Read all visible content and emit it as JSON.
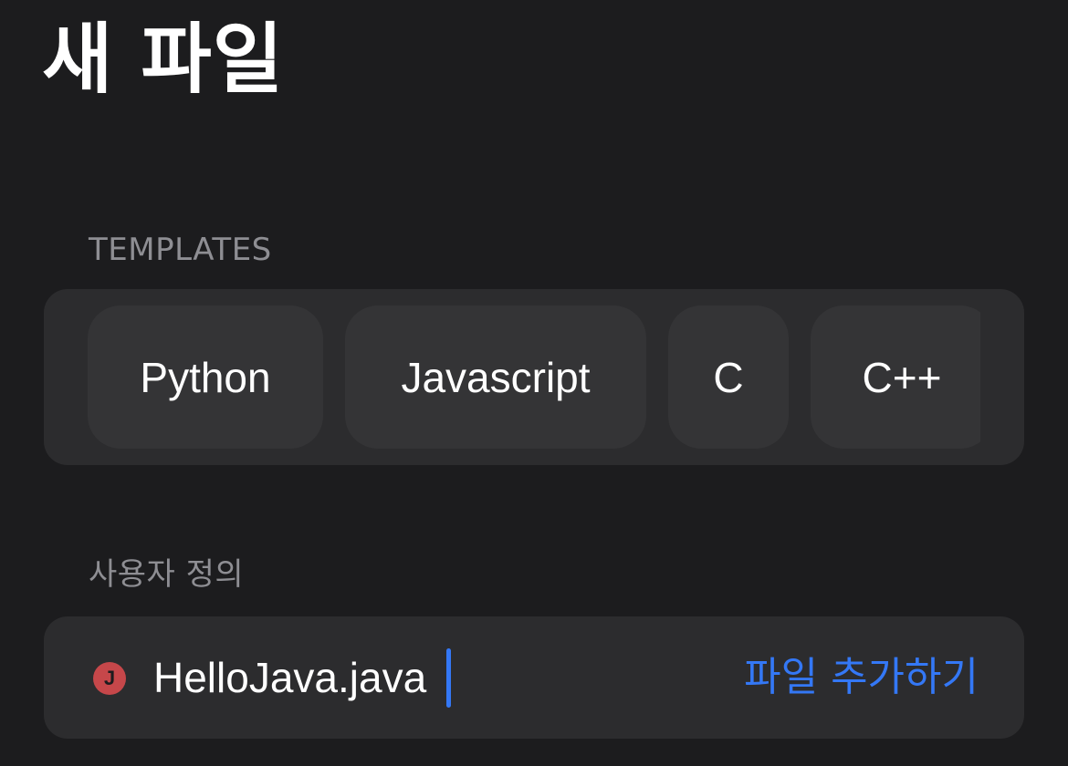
{
  "header": {
    "title": "새 파일"
  },
  "templates": {
    "label": "TEMPLATES",
    "items": [
      {
        "label": "Python"
      },
      {
        "label": "Javascript"
      },
      {
        "label": "C"
      },
      {
        "label": "C++"
      }
    ]
  },
  "custom": {
    "label": "사용자 정의",
    "file_icon": {
      "name": "java-file-icon",
      "glyph": "J",
      "color": "#c6474a"
    },
    "filename_value": "HelloJava.java",
    "add_button_label": "파일 추가하기"
  },
  "colors": {
    "background": "#1c1c1e",
    "card": "#2c2c2e",
    "accent": "#3478f6"
  }
}
